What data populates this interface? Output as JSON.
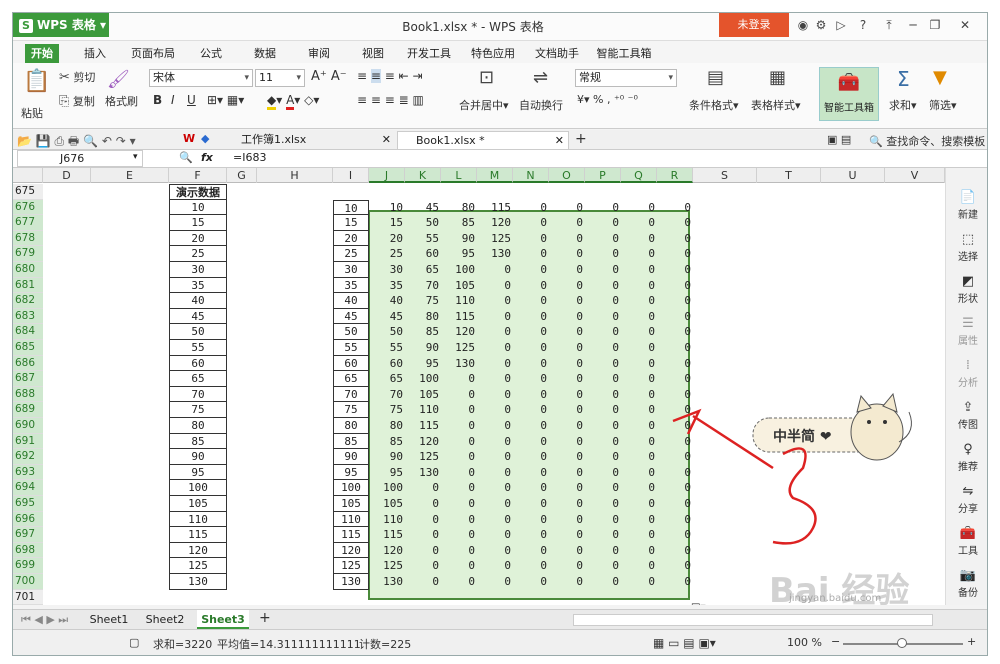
{
  "window": {
    "app": "WPS 表格",
    "title": "Book1.xlsx * - WPS 表格",
    "login": "未登录"
  },
  "tabs": [
    "开始",
    "插入",
    "页面布局",
    "公式",
    "数据",
    "审阅",
    "视图",
    "开发工具",
    "特色应用",
    "文档助手",
    "智能工具箱"
  ],
  "ribbon": {
    "paste": "粘贴",
    "cut": "剪切",
    "copy": "复制",
    "format_painter": "格式刷",
    "font": "宋体",
    "size": "11",
    "merge": "合并居中",
    "wrap": "自动换行",
    "numfmt": "常规",
    "cond": "条件格式",
    "table_style": "表格样式",
    "ai": "智能工具箱",
    "sum": "求和",
    "filter": "筛选"
  },
  "doc_tabs": [
    "工作簿1.xlsx",
    "Book1.xlsx *"
  ],
  "search": "查找命令、搜索模板",
  "formula": {
    "namebox": "J676",
    "fx": "fx",
    "text": "=I683"
  },
  "columns": [
    "D",
    "E",
    "F",
    "G",
    "H",
    "I",
    "J",
    "K",
    "L",
    "M",
    "N",
    "O",
    "P",
    "Q",
    "R",
    "S",
    "T",
    "U",
    "V"
  ],
  "rows": [
    "675",
    "676",
    "677",
    "678",
    "679",
    "680",
    "681",
    "682",
    "683",
    "684",
    "685",
    "686",
    "687",
    "688",
    "689",
    "690",
    "691",
    "692",
    "693",
    "694",
    "695",
    "696",
    "697",
    "698",
    "699",
    "700",
    "701"
  ],
  "header_cell": "演示数据",
  "f_values": [
    "10",
    "15",
    "20",
    "25",
    "30",
    "35",
    "40",
    "45",
    "50",
    "55",
    "60",
    "65",
    "70",
    "75",
    "80",
    "85",
    "90",
    "95",
    "100",
    "105",
    "110",
    "115",
    "120",
    "125",
    "130"
  ],
  "i_values": [
    "10",
    "15",
    "20",
    "25",
    "30",
    "35",
    "40",
    "45",
    "50",
    "55",
    "60",
    "65",
    "70",
    "75",
    "80",
    "85",
    "90",
    "95",
    "100",
    "105",
    "110",
    "115",
    "120",
    "125",
    "130"
  ],
  "sticker": "中半简 ❤",
  "sidebar": [
    "新建",
    "选择",
    "形状",
    "属性",
    "分析",
    "传图",
    "推荐",
    "分享",
    "工具",
    "备份"
  ],
  "sheets": [
    "Sheet1",
    "Sheet2",
    "Sheet3"
  ],
  "status": {
    "sum": "求和=3220",
    "avg": "平均值=14.311111111111",
    "count": "计数=225",
    "zoom": "100 %"
  },
  "watermark": "Bai 经验",
  "watermark_url": "jingyan.baidu.com"
}
